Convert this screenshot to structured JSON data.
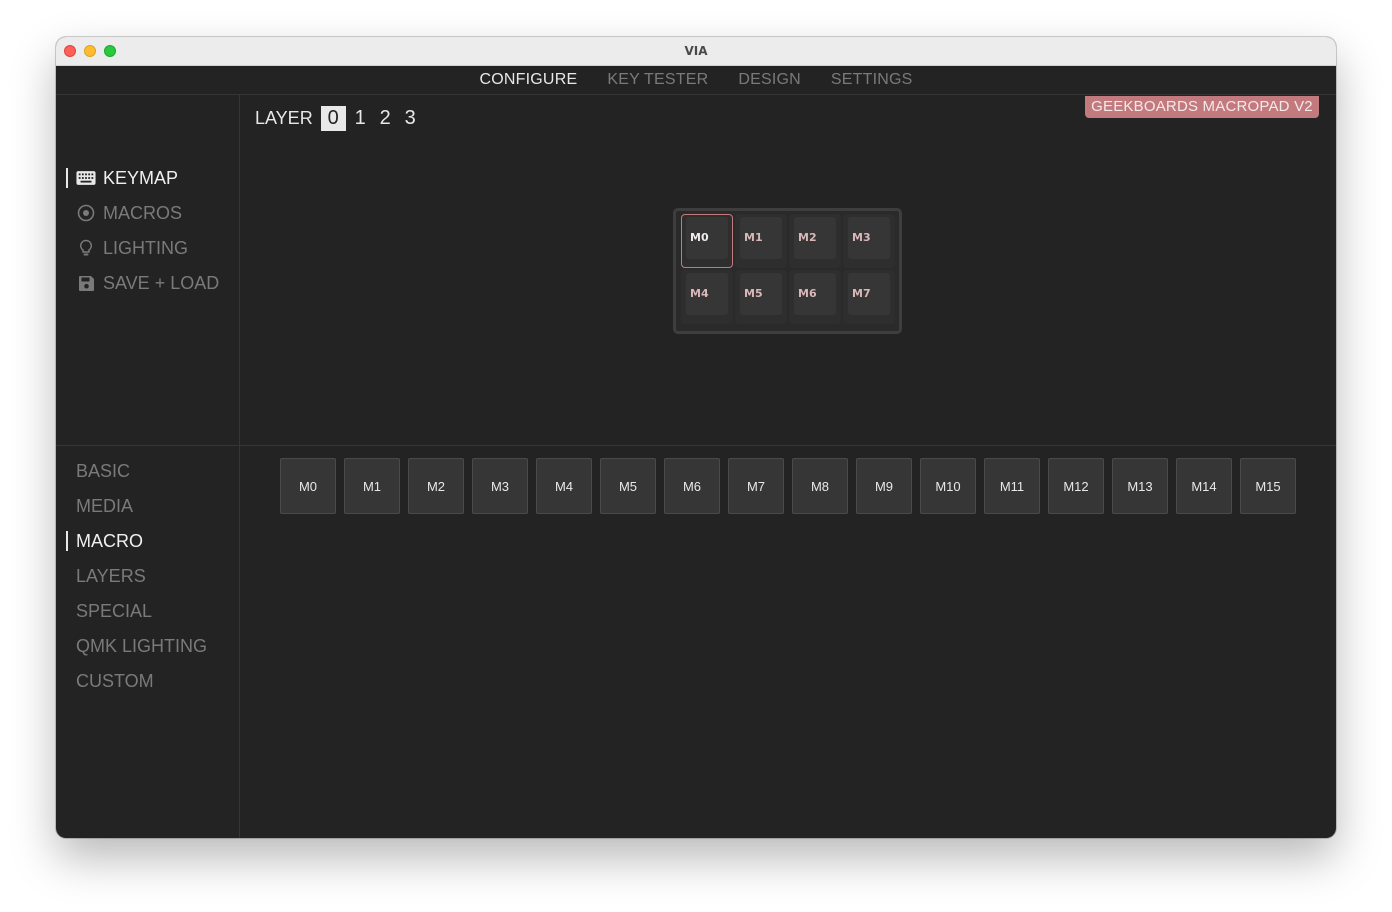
{
  "window": {
    "title": "VIA"
  },
  "topnav": {
    "tabs": [
      {
        "label": "CONFIGURE"
      },
      {
        "label": "KEY TESTER"
      },
      {
        "label": "DESIGN"
      },
      {
        "label": "SETTINGS"
      }
    ],
    "active": "CONFIGURE"
  },
  "sidebar": {
    "items": [
      {
        "label": "KEYMAP",
        "icon": "keyboard-icon"
      },
      {
        "label": "MACROS",
        "icon": "record-circle-icon"
      },
      {
        "label": "LIGHTING",
        "icon": "lightbulb-icon"
      },
      {
        "label": "SAVE + LOAD",
        "icon": "floppy-disk-icon"
      }
    ],
    "active": "KEYMAP"
  },
  "layers": {
    "label": "LAYER",
    "items": [
      "0",
      "1",
      "2",
      "3"
    ],
    "active": "0"
  },
  "device": {
    "name": "GEEKBOARDS MACROPAD V2"
  },
  "keyboard": {
    "rows": [
      [
        "M0",
        "M1",
        "M2",
        "M3"
      ],
      [
        "M4",
        "M5",
        "M6",
        "M7"
      ]
    ],
    "selected": "M0"
  },
  "categories": {
    "items": [
      "BASIC",
      "MEDIA",
      "MACRO",
      "LAYERS",
      "SPECIAL",
      "QMK LIGHTING",
      "CUSTOM"
    ],
    "active": "MACRO"
  },
  "macro_keys": [
    "M0",
    "M1",
    "M2",
    "M3",
    "M4",
    "M5",
    "M6",
    "M7",
    "M8",
    "M9",
    "M10",
    "M11",
    "M12",
    "M13",
    "M14",
    "M15"
  ],
  "colors": {
    "accent": "#c37a7e",
    "background": "#232323",
    "text": "#e8e8e8",
    "muted": "#7a7a7a"
  }
}
